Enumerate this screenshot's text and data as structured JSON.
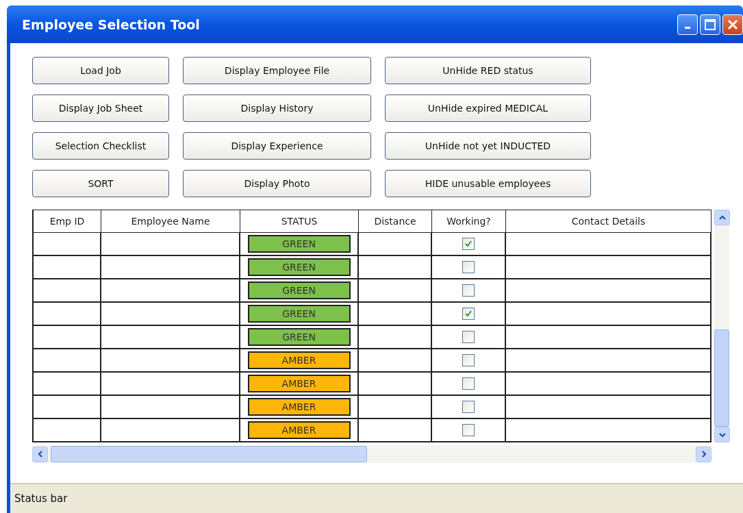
{
  "window": {
    "title": "Employee Selection Tool"
  },
  "button_columns": [
    [
      "Load Job",
      "Display Job Sheet",
      "Selection Checklist",
      "SORT"
    ],
    [
      "Display Employee File",
      "Display History",
      "Display Experience",
      "Display Photo"
    ],
    [
      "UnHide RED status",
      "UnHide expired MEDICAL",
      "UnHide not yet INDUCTED",
      "HIDE unusable employees"
    ]
  ],
  "table": {
    "columns": [
      "Emp ID",
      "Employee Name",
      "STATUS",
      "Distance",
      "Working?",
      "Contact Details"
    ],
    "rows": [
      {
        "status": "GREEN",
        "color": "#7dc04a",
        "working": true
      },
      {
        "status": "GREEN",
        "color": "#7dc04a",
        "working": false
      },
      {
        "status": "GREEN",
        "color": "#7dc04a",
        "working": false
      },
      {
        "status": "GREEN",
        "color": "#7dc04a",
        "working": true
      },
      {
        "status": "GREEN",
        "color": "#7dc04a",
        "working": false
      },
      {
        "status": "AMBER",
        "color": "#ffb60a",
        "working": false
      },
      {
        "status": "AMBER",
        "color": "#ffb60a",
        "working": false
      },
      {
        "status": "AMBER",
        "color": "#ffb60a",
        "working": false
      },
      {
        "status": "AMBER",
        "color": "#ffb60a",
        "working": false
      }
    ]
  },
  "status_bar": "Status bar"
}
